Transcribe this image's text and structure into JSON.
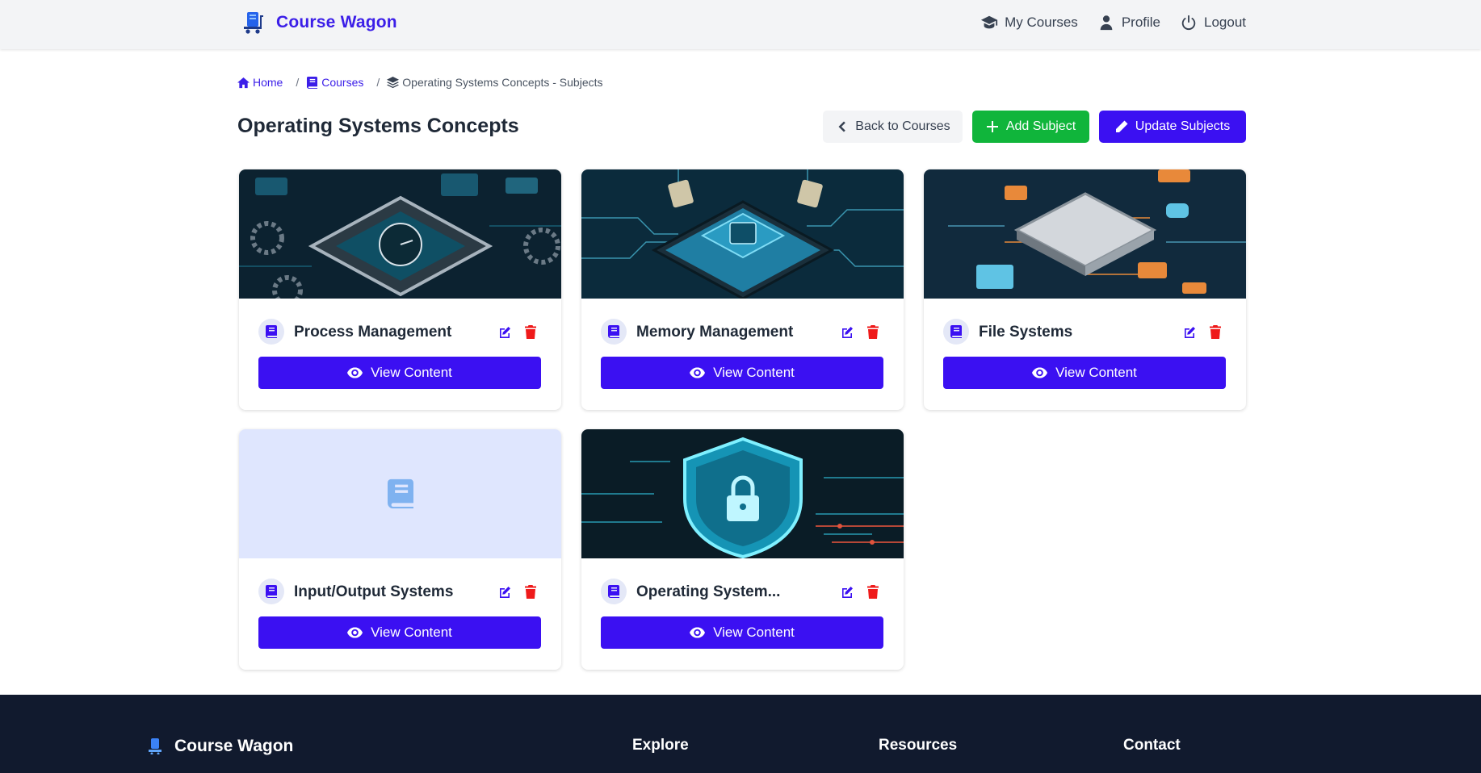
{
  "navbar": {
    "brand": "Course Wagon",
    "links": [
      {
        "label": "My Courses",
        "icon": "graduation-cap-icon"
      },
      {
        "label": "Profile",
        "icon": "user-icon"
      },
      {
        "label": "Logout",
        "icon": "power-icon"
      }
    ]
  },
  "breadcrumb": [
    {
      "label": "Home",
      "icon": "home-icon"
    },
    {
      "label": "Courses",
      "icon": "book-icon"
    },
    {
      "label": "Operating Systems Concepts - Subjects",
      "icon": "layers-icon"
    }
  ],
  "page": {
    "title": "Operating Systems Concepts",
    "actions": {
      "back": "Back to Courses",
      "add": "Add Subject",
      "update": "Update Subjects"
    }
  },
  "subjects": [
    {
      "title": "Process Management",
      "button": "View Content",
      "image": "cpu-clock-chip-image"
    },
    {
      "title": "Memory Management",
      "button": "View Content",
      "image": "memory-chip-image"
    },
    {
      "title": "File Systems",
      "button": "View Content",
      "image": "file-systems-chip-image"
    },
    {
      "title": "Input/Output Systems",
      "button": "View Content",
      "image": "book-placeholder"
    },
    {
      "title": "Operating System...",
      "button": "View Content",
      "image": "security-shield-image"
    }
  ],
  "footer": {
    "brand": "Course Wagon",
    "columns": [
      "Explore",
      "Resources",
      "Contact"
    ]
  },
  "colors": {
    "primary": "#3b10f2",
    "success": "#10b53b",
    "danger": "#ef1a1a",
    "footer_bg": "#111a2e",
    "navbar_bg": "#f3f4f6"
  }
}
